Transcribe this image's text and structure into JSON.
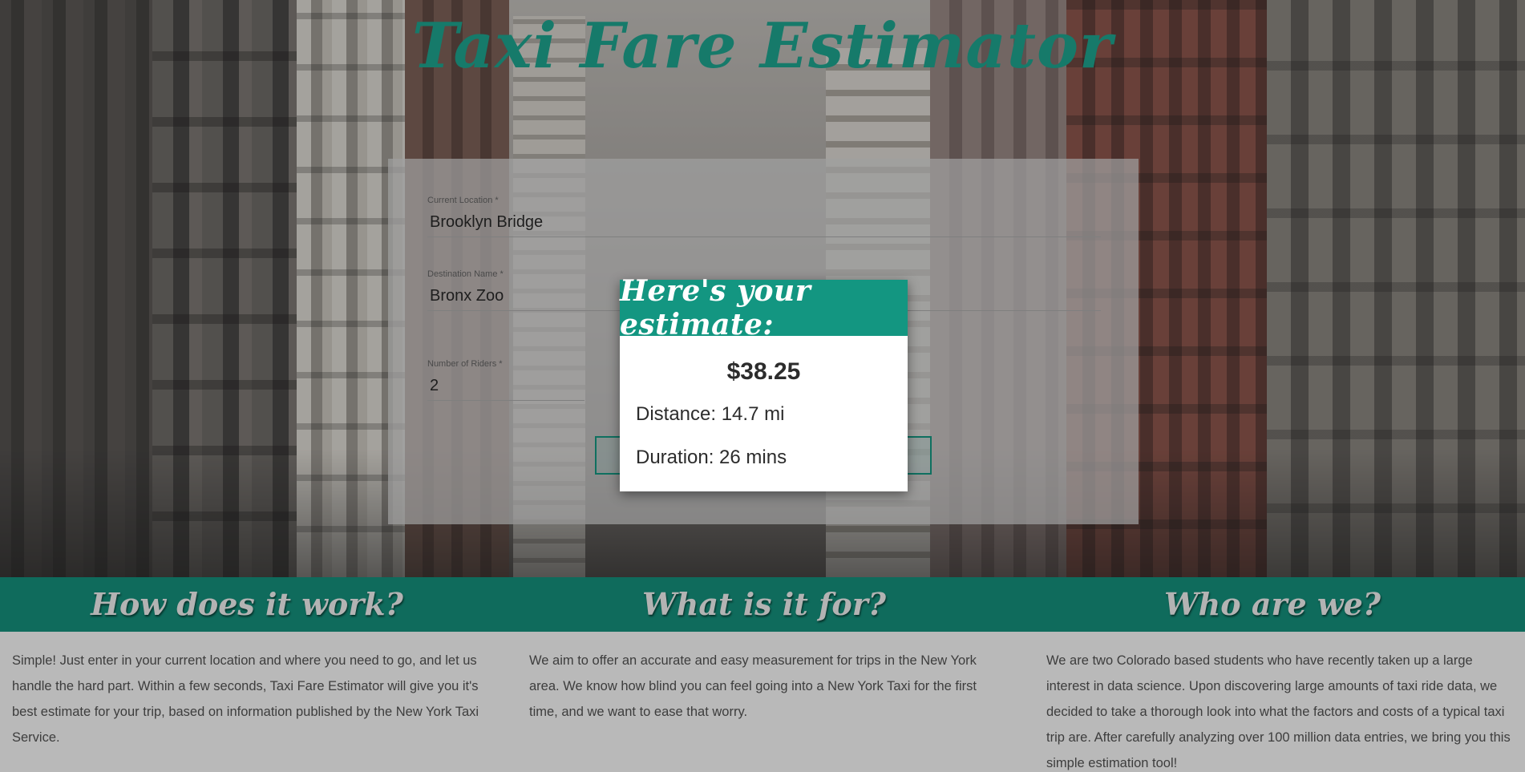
{
  "app": {
    "title": "Taxi Fare Estimator"
  },
  "form": {
    "current_location": {
      "label": "Current Location *",
      "value": "Brooklyn Bridge"
    },
    "destination": {
      "label": "Destination Name *",
      "value": "Bronx Zoo"
    },
    "riders": {
      "label": "Number of Riders *",
      "value": "2"
    }
  },
  "estimate": {
    "heading": "Here's your estimate:",
    "price": "$38.25",
    "distance": "Distance: 14.7 mi",
    "duration": "Duration: 26 mins"
  },
  "info": {
    "sections": [
      {
        "heading": "How does it work?",
        "text": "Simple! Just enter in your current location and where you need to go, and let us handle the hard part. Within a few seconds, Taxi Fare Estimator will give you it's best estimate for your trip, based on information published by the New York Taxi Service."
      },
      {
        "heading": "What is it for?",
        "text": "We aim to offer an accurate and easy measurement for trips in the New York area. We know how blind you can feel going into a New York Taxi for the first time, and we want to ease that worry."
      },
      {
        "heading": "Who are we?",
        "text": "We are two Colorado based students who have recently taken up a large interest in data science. Upon discovering large amounts of taxi ride data, we decided to take a thorough look into what the factors and costs of a typical taxi trip are. After carefully analyzing over 100 million data entries, we bring you this simple estimation tool!"
      }
    ]
  },
  "colors": {
    "brand_teal": "#167a6a",
    "popup_header": "#139681",
    "band": "#0f6b5c"
  }
}
